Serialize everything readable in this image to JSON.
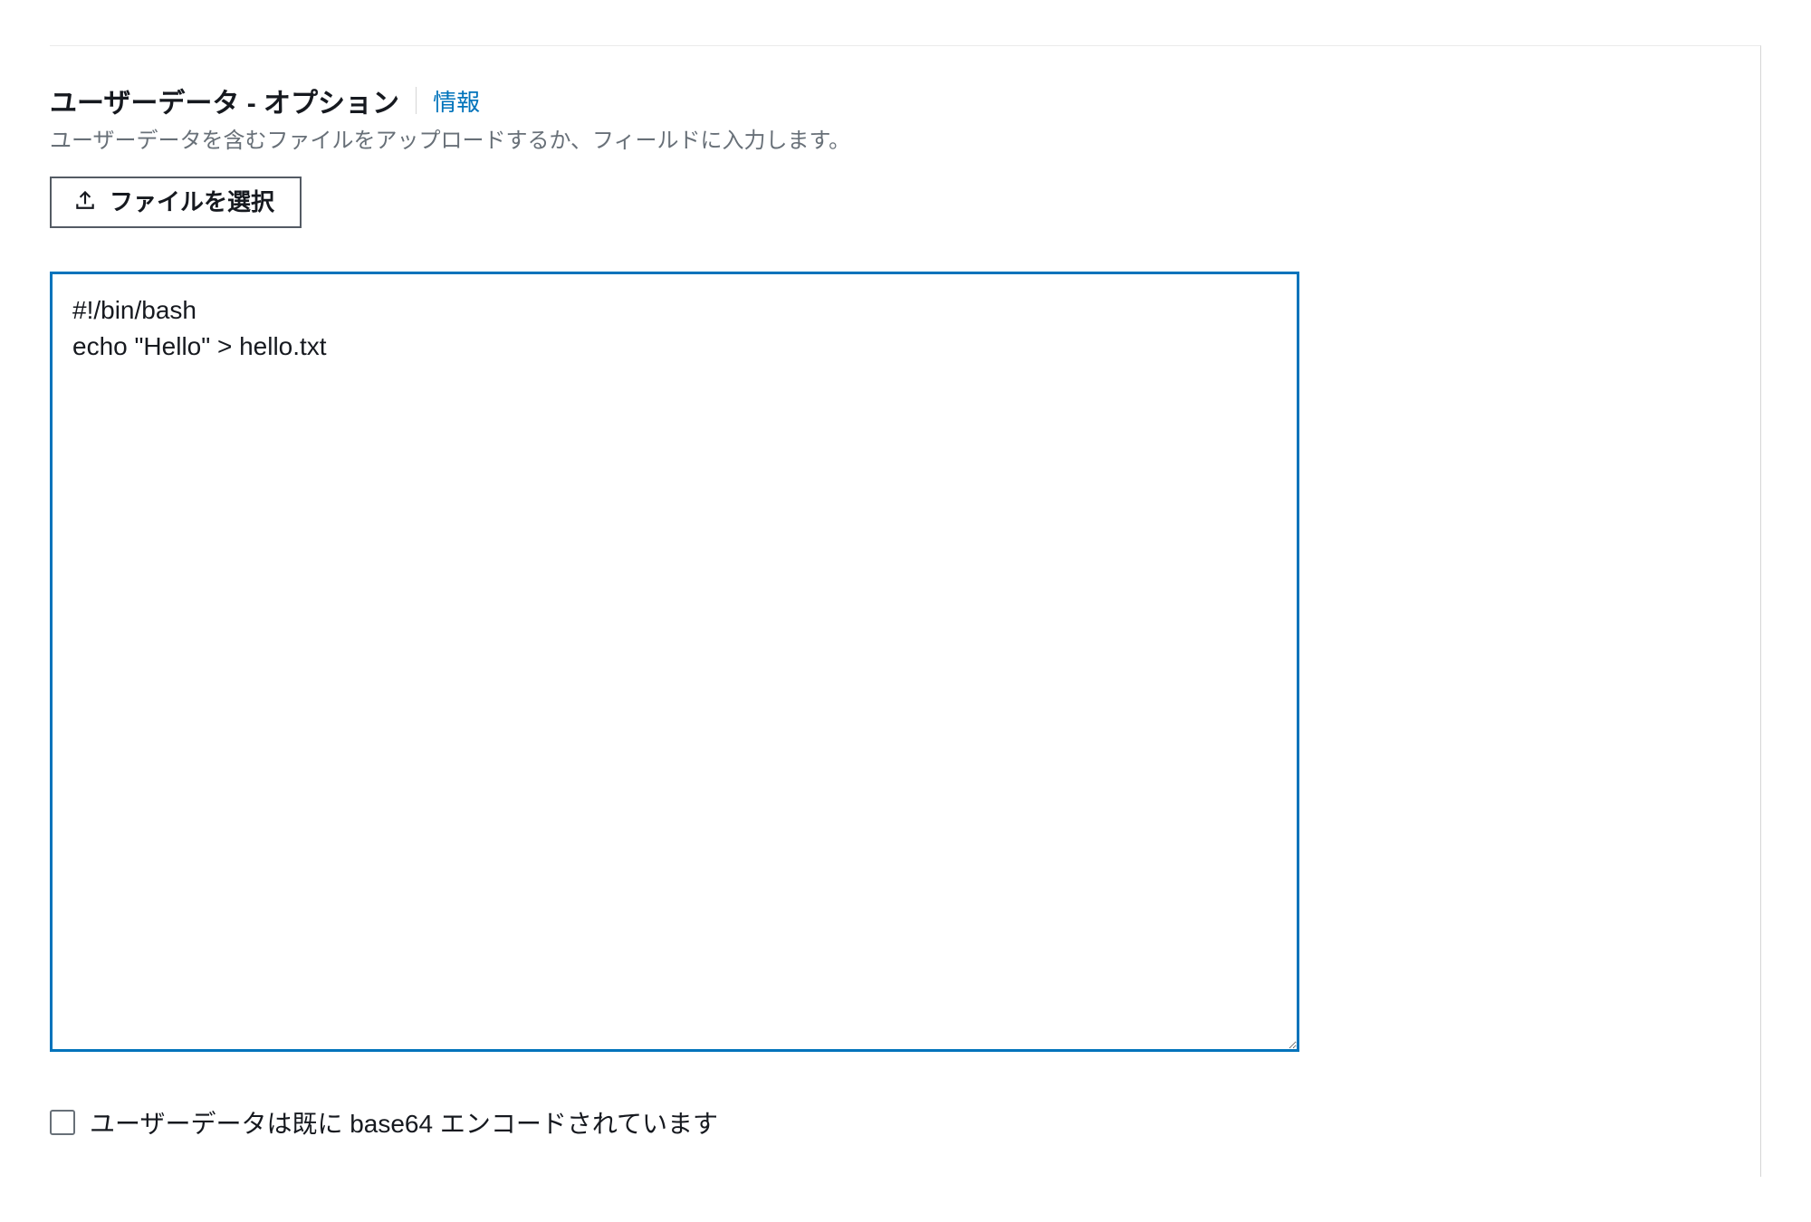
{
  "section": {
    "title": "ユーザーデータ - オプション",
    "info_link": "情報",
    "description": "ユーザーデータを含むファイルをアップロードするか、フィールドに入力します。",
    "file_button_label": "ファイルを選択",
    "user_data_value": "#!/bin/bash\necho \"Hello\" > hello.txt",
    "base64_checkbox_label": "ユーザーデータは既に base64 エンコードされています",
    "base64_checked": false
  }
}
